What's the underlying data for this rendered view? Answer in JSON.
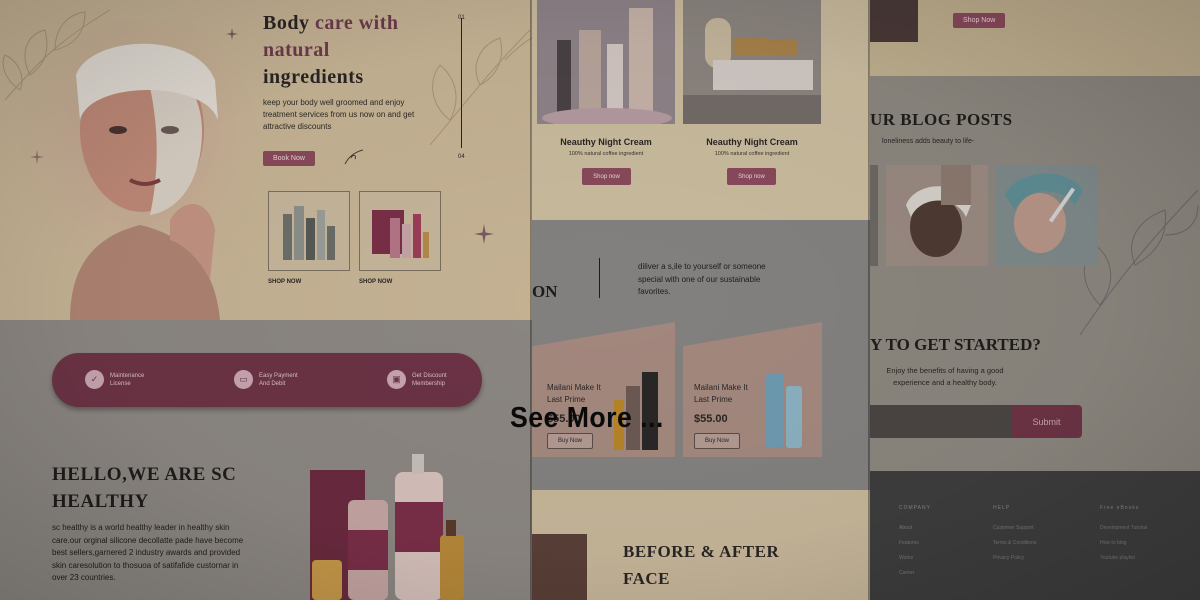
{
  "panel1": {
    "headline": {
      "part1": "Body ",
      "part2": "care with",
      "line2": "natural",
      "line3": "ingredients"
    },
    "subtext": "keep your body well groomed and enjoy treatment services from us now on and get attractive discounts",
    "book_now": "Book Now",
    "slider_num_top": "01",
    "slider_num_bottom": "04",
    "shop_now_1": "SHOP NOW",
    "shop_now_2": "SHOP NOW",
    "features": [
      {
        "icon": "shield-icon",
        "label": "Maintenance License"
      },
      {
        "icon": "card-icon",
        "label": "Easy Payment And Debit"
      },
      {
        "icon": "gift-icon",
        "label": "Get Discount Membership"
      }
    ],
    "hello_title": "HELLO,WE ARE SC HEALTHY",
    "hello_text": "sc healthy is a world healthy leader in healthy skin care.our orginal silicone decollatte pade have become best sellers,garnered 2 industry awards and provided skin caresolution to thosuoa of satifafide custornar in over 23 countries."
  },
  "panel2": {
    "products": [
      {
        "title": "Neauthy Night Cream",
        "subtitle": "100% natural coffee ingredient",
        "button": "Shop now"
      },
      {
        "title": "Neauthy Night Cream",
        "subtitle": "100% natural coffee ingredient",
        "button": "Shop now"
      }
    ],
    "section_partial": "ON",
    "section_text": "diliver a s,ile to yourself or someone special with one of our sustainable favorites.",
    "cards": [
      {
        "title": "Mailani Make It Last Prime",
        "price": "$55.00",
        "button": "Buy Now"
      },
      {
        "title": "Mailani Make It Last Prime",
        "price": "$55.00",
        "button": "Buy Now"
      }
    ],
    "before_after": "BEFORE & AFTER FACE"
  },
  "panel3": {
    "shop_now": "Shop Now",
    "blog_title": "UR BLOG POSTS",
    "blog_sub": "loneliness adds beauty to life-",
    "started_title": "Y TO GET STARTED?",
    "started_text": "Enjoy the benefits of having a good experience and a healthy body.",
    "submit": "Submit",
    "footer": {
      "company": {
        "heading": "COMPANY",
        "links": [
          "About",
          "Features",
          "Works",
          "Career"
        ]
      },
      "help": {
        "heading": "HELP",
        "links": [
          "Customer Support",
          "Terms & Conditions",
          "Privacy Policy"
        ]
      },
      "ebooks": {
        "heading": "Free eBooks",
        "links": [
          "Development Tutorial",
          "How to blog",
          "Youtube playlist"
        ]
      }
    }
  },
  "overlay": {
    "see_more": "See More ..."
  },
  "colors": {
    "accent": "#6d3446",
    "cream": "#c8b596",
    "dark": "#2b2626"
  }
}
